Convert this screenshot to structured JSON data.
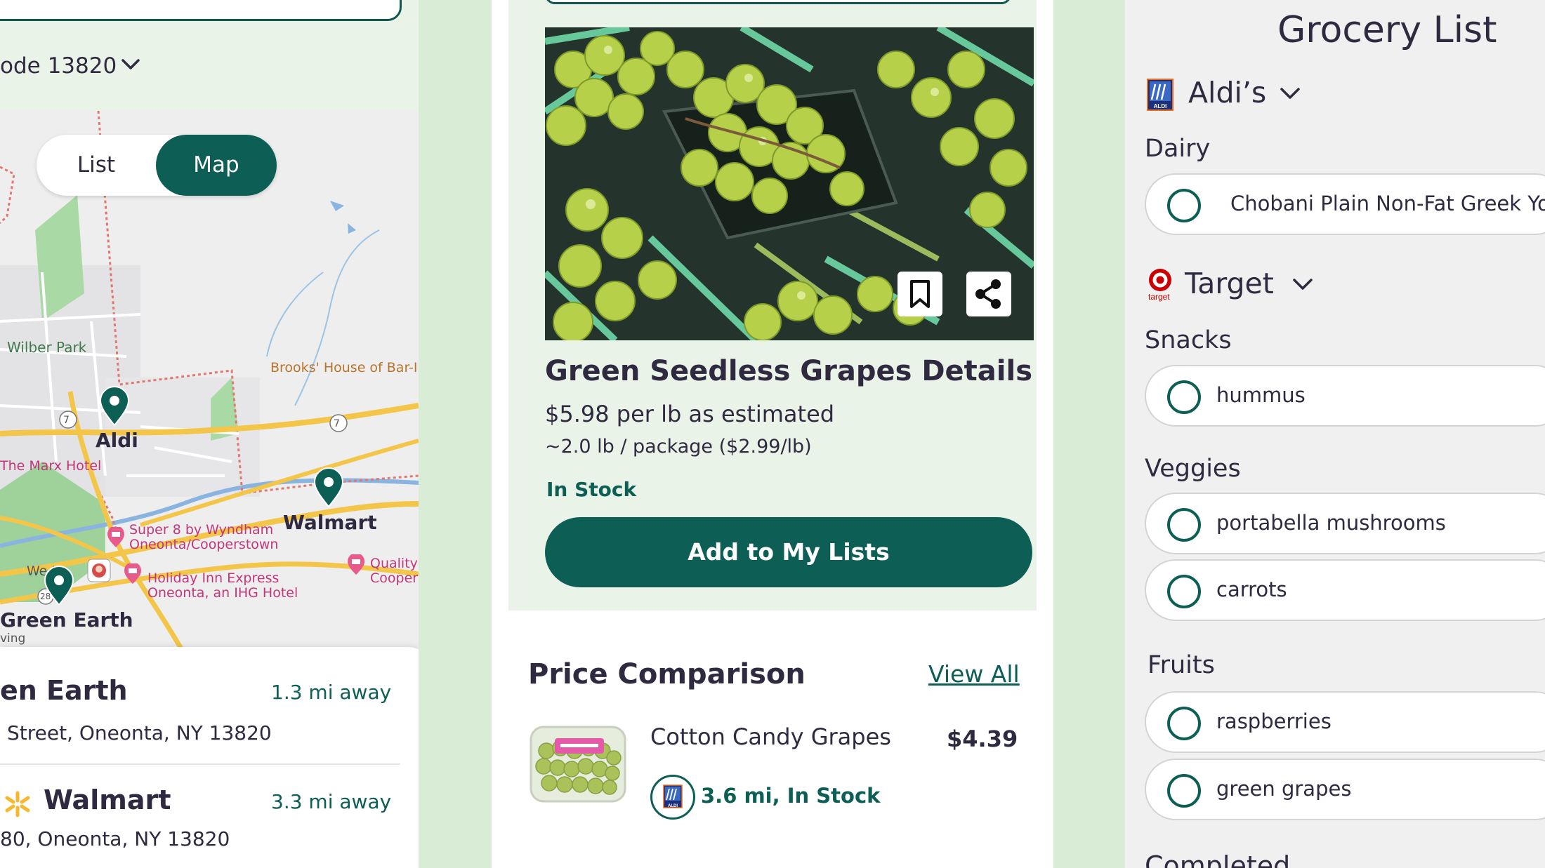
{
  "colors": {
    "primary": "#0d5e55",
    "background": "#d9ecd5",
    "card": "#e9f3e7",
    "text": "#2f2a40"
  },
  "store_finder": {
    "zip_label": "ode 13820",
    "toggle": {
      "list": "List",
      "map": "Map",
      "selected": "Map"
    },
    "map_labels": {
      "park": "Wilber Park",
      "brooks": "Brooks' House of Bar-I",
      "aldi": "Aldi",
      "marx": "The Marx Hotel",
      "walmart": "Walmart",
      "super8_line1": "Super 8 by Wyndham",
      "super8_line2": "Oneonta/Cooperstown",
      "holiday_line1": "Holiday Inn Express",
      "holiday_line2": "Oneonta, an IHG Hotel",
      "quality_line1": "Quality",
      "quality_line2": "Cooper",
      "wendys": "We    's",
      "green_earth": "Green Earth",
      "ving": "ving",
      "route_7a": "7",
      "route_7b": "7",
      "route_28": "28"
    },
    "stores": [
      {
        "name": "en Earth",
        "distance": "1.3 mi away",
        "address": "Street, Oneonta, NY 13820"
      },
      {
        "name": "Walmart",
        "distance": "3.3 mi away",
        "address": "80, Oneonta, NY 13820"
      }
    ]
  },
  "product": {
    "title": "Green Seedless Grapes Details",
    "price": "$5.98 per lb as estimated",
    "package": "~2.0 lb  / package ($2.99/lb)",
    "stock": "In Stock",
    "add_button": "Add to My Lists",
    "icons": [
      "bookmark-icon",
      "share-icon"
    ],
    "comparison": {
      "title": "Price Comparison",
      "view_all": "View All",
      "items": [
        {
          "name": "Cotton Candy Grapes",
          "price": "$4.39",
          "store_icon": "aldi-logo",
          "availability": "3.6 mi, In Stock"
        }
      ]
    }
  },
  "grocery_list": {
    "title": "Grocery List",
    "stores": [
      {
        "name": "Aldi’s",
        "logo": "aldi-logo",
        "categories": [
          {
            "name": "Dairy",
            "items": [
              "Chobani Plain Non-Fat Greek Yo"
            ]
          }
        ]
      },
      {
        "name": "Target",
        "logo": "target-logo",
        "logo_caption": "target",
        "categories": [
          {
            "name": "Snacks",
            "items": [
              "hummus"
            ]
          },
          {
            "name": "Veggies",
            "items": [
              "portabella mushrooms",
              "carrots"
            ]
          },
          {
            "name": "Fruits",
            "items": [
              "raspberries",
              "green grapes"
            ]
          }
        ]
      }
    ],
    "completed_label": "Completed"
  }
}
